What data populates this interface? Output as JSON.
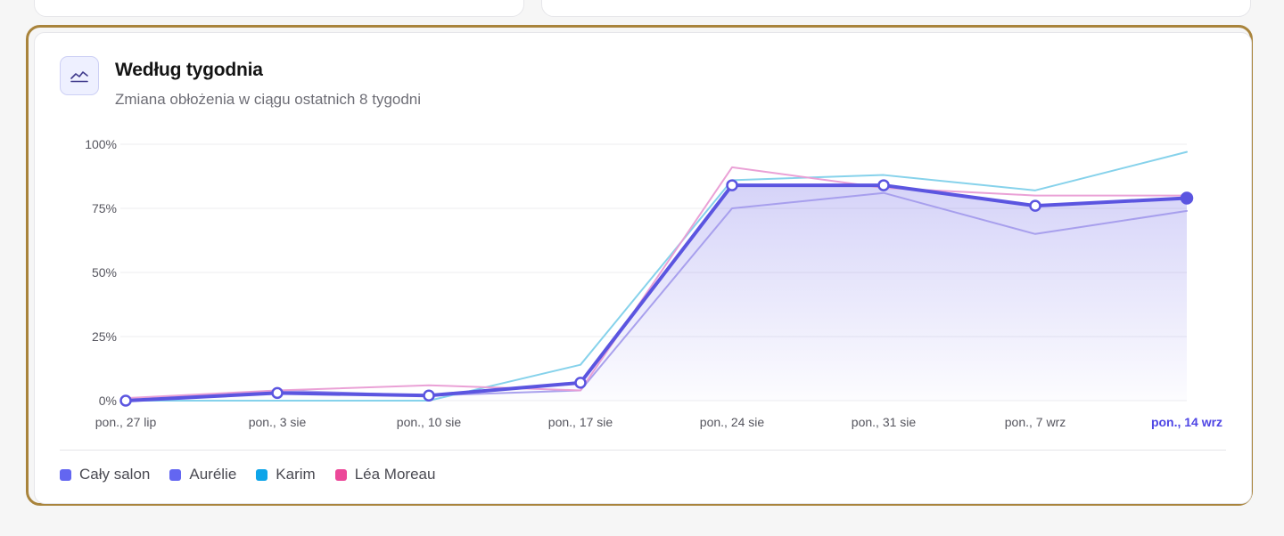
{
  "card": {
    "title": "Według tygodnia",
    "subtitle": "Zmiana obłożenia w ciągu ostatnich 8 tygodni",
    "icon": "line-chart-icon"
  },
  "colors": {
    "accent": "#5b55e0",
    "highlight_border": "#a9843c",
    "aurelie": "#a49cec",
    "karim": "#7fd0ea",
    "lea": "#e99cd4"
  },
  "chart_data": {
    "type": "line",
    "x": [
      "pon., 27 lip",
      "pon., 3 sie",
      "pon., 10 sie",
      "pon., 17 sie",
      "pon., 24 sie",
      "pon., 31 sie",
      "pon., 7 wrz",
      "pon., 14 wrz"
    ],
    "highlighted_x": "pon., 14 wrz",
    "y_ticks": [
      "100%",
      "75%",
      "50%",
      "25%",
      "0%"
    ],
    "ylim": [
      0,
      100
    ],
    "grid": true,
    "legend_position": "bottom-left",
    "series": [
      {
        "name": "Cały salon",
        "values": [
          0,
          3,
          2,
          7,
          84,
          84,
          76,
          79
        ],
        "color": "#5b55e0",
        "legend_color": "#6366f1",
        "emphasis": true,
        "area_fill": true
      },
      {
        "name": "Aurélie",
        "values": [
          0,
          4,
          2,
          4,
          75,
          81,
          65,
          74
        ],
        "color": "#a49cec",
        "legend_color": "#6366f1"
      },
      {
        "name": "Karim",
        "values": [
          0,
          0,
          0,
          14,
          86,
          88,
          82,
          97
        ],
        "color": "#7fd0ea",
        "legend_color": "#0ea5e9"
      },
      {
        "name": "Léa Moreau",
        "values": [
          1,
          4,
          6,
          4,
          91,
          83,
          80,
          80
        ],
        "color": "#e99cd4",
        "legend_color": "#ec4899"
      }
    ]
  }
}
